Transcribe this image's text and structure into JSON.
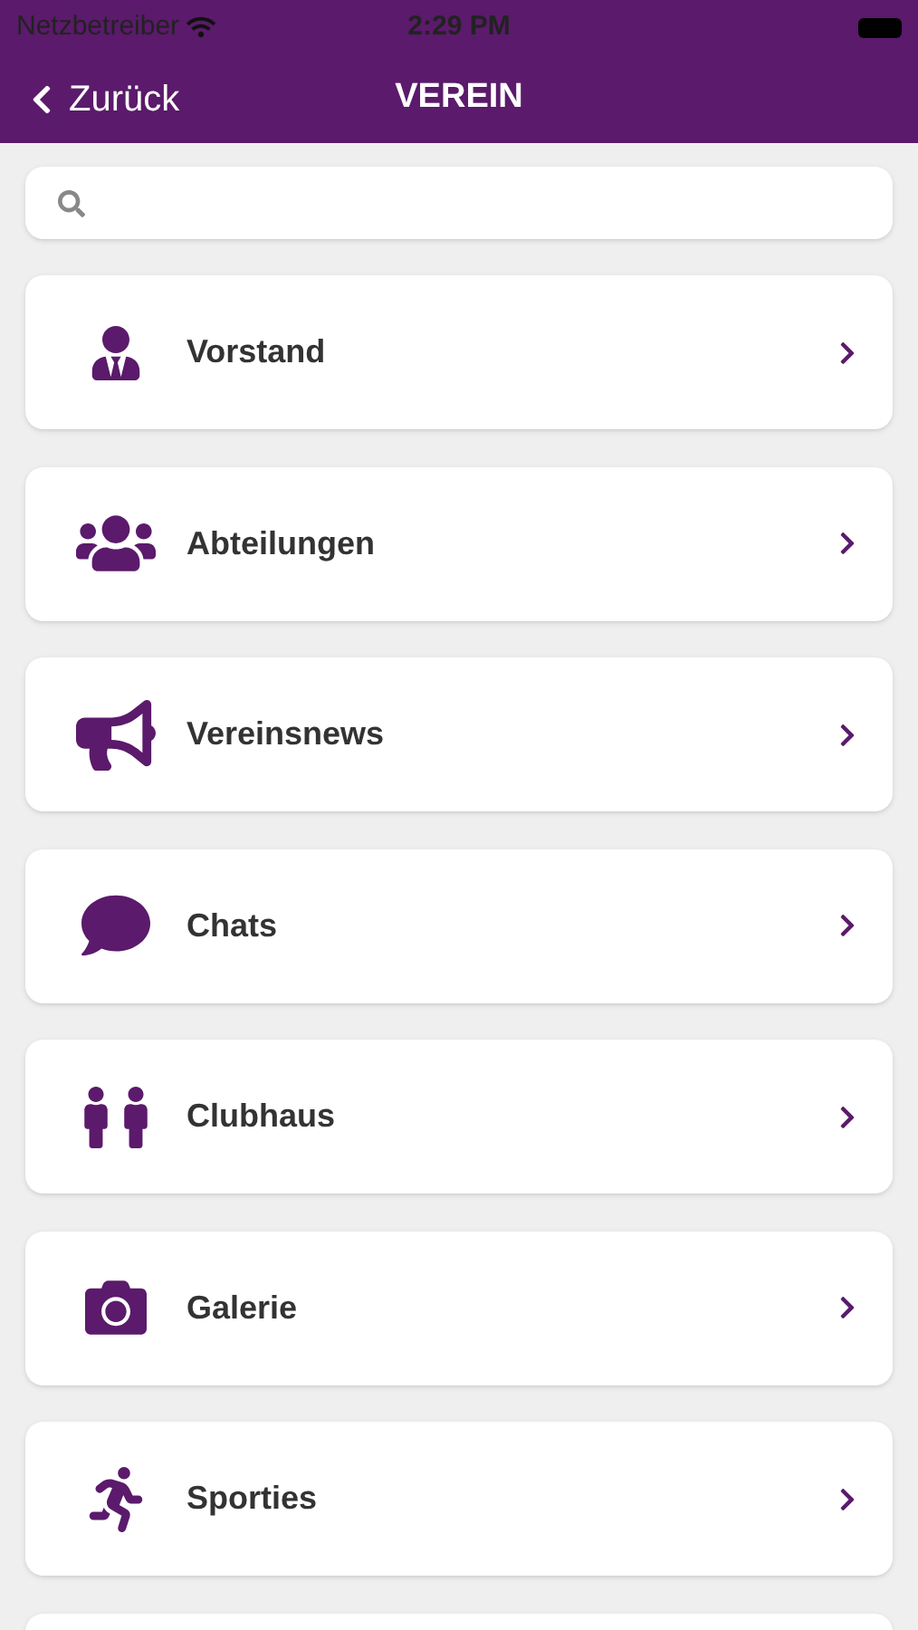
{
  "status_bar": {
    "carrier": "Netzbetreiber",
    "time": "2:29 PM"
  },
  "nav": {
    "back": "Zurück",
    "title": "VEREIN"
  },
  "items": [
    {
      "label": "Vorstand",
      "kind": "board"
    },
    {
      "label": "Abteilungen",
      "kind": "groups"
    },
    {
      "label": "Vereinsnews",
      "kind": "news"
    },
    {
      "label": "Chats",
      "kind": "chat"
    },
    {
      "label": "Clubhaus",
      "kind": "clubhouse"
    },
    {
      "label": "Galerie",
      "kind": "gallery"
    },
    {
      "label": "Sporties",
      "kind": "sports"
    }
  ]
}
